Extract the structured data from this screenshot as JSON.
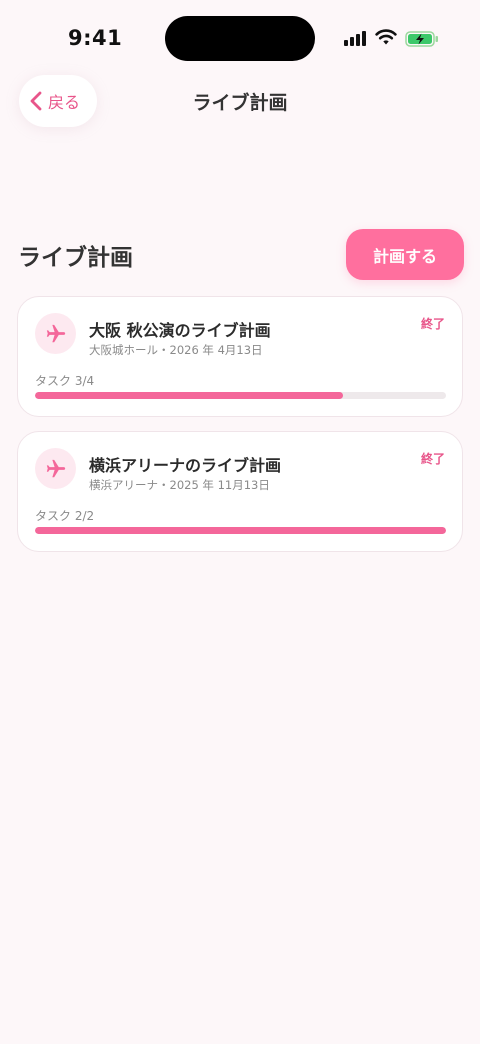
{
  "status_bar": {
    "time": "9:41"
  },
  "nav": {
    "back_label": "戻る",
    "title": "ライブ計画"
  },
  "section": {
    "title": "ライブ計画",
    "plan_button": "計画する"
  },
  "colors": {
    "accent": "#ff6f9e",
    "accent_text": "#e8558a",
    "background": "#fdf7f9"
  },
  "plans": [
    {
      "icon": "airplane-icon",
      "title": "大阪 秋公演のライブ計画",
      "subtitle": "大阪城ホール・2026 年 4月13日",
      "badge": "終了",
      "tasks_label": "タスク 3/4",
      "progress": 0.75
    },
    {
      "icon": "airplane-icon",
      "title": "横浜アリーナのライブ計画",
      "subtitle": "横浜アリーナ・2025 年 11月13日",
      "badge": "終了",
      "tasks_label": "タスク 2/2",
      "progress": 1.0
    }
  ]
}
